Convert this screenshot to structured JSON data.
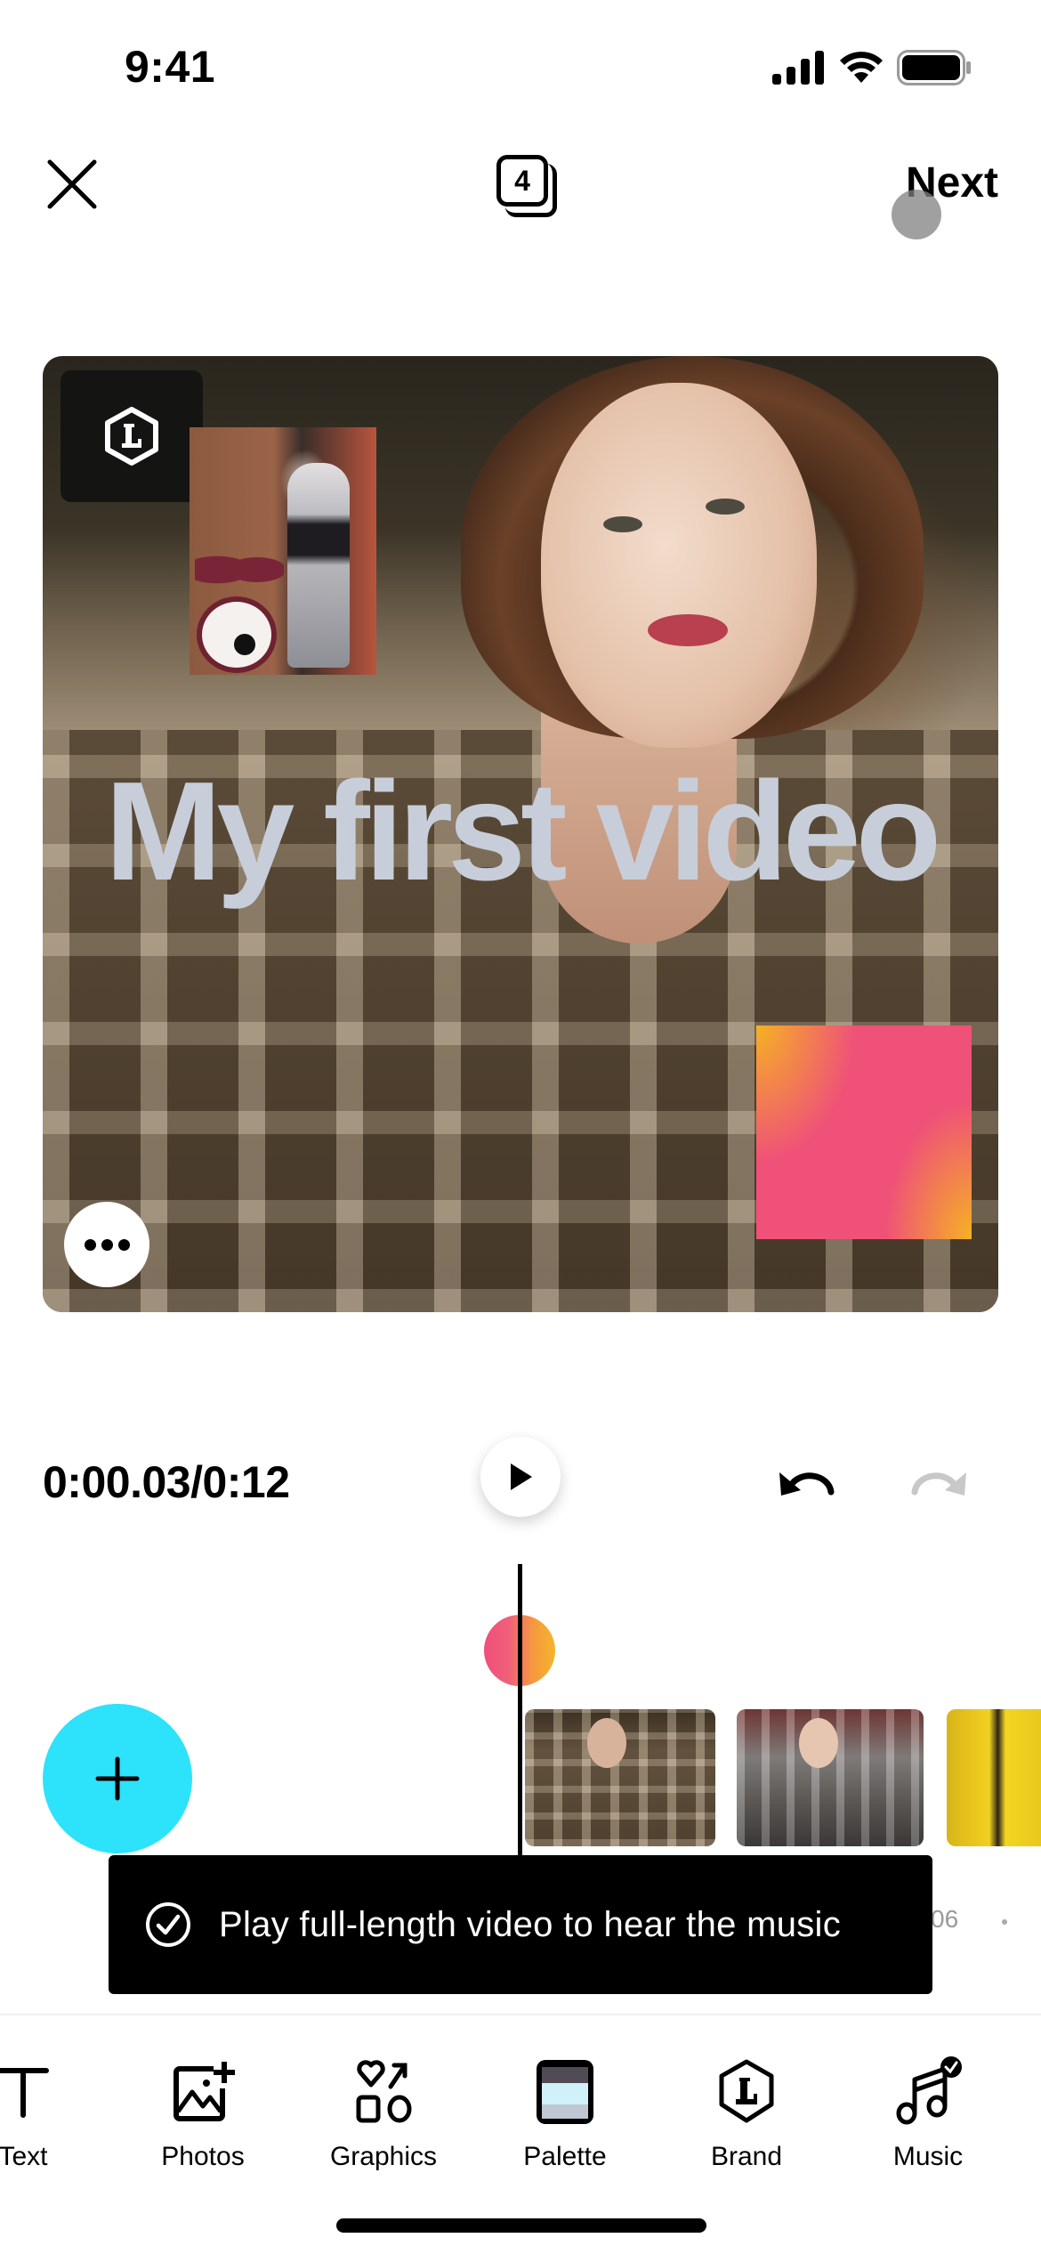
{
  "status_bar": {
    "time": "9:41"
  },
  "top_bar": {
    "page_count": "4",
    "next_label": "Next"
  },
  "canvas": {
    "title_text": "My first video"
  },
  "playback": {
    "time_readout": "0:00.03/0:12"
  },
  "timeline": {
    "tick_label": "06"
  },
  "toast": {
    "message": "Play full-length video to hear the music"
  },
  "toolbar": {
    "items": [
      {
        "label": "Text"
      },
      {
        "label": "Photos"
      },
      {
        "label": "Graphics"
      },
      {
        "label": "Palette"
      },
      {
        "label": "Brand"
      },
      {
        "label": "Music"
      }
    ]
  },
  "colors": {
    "accent_add_button": "#2de2fb",
    "gradient_pink": "#ef5178",
    "gradient_yellow": "#f5b124",
    "title_text": "#c7ced9"
  }
}
